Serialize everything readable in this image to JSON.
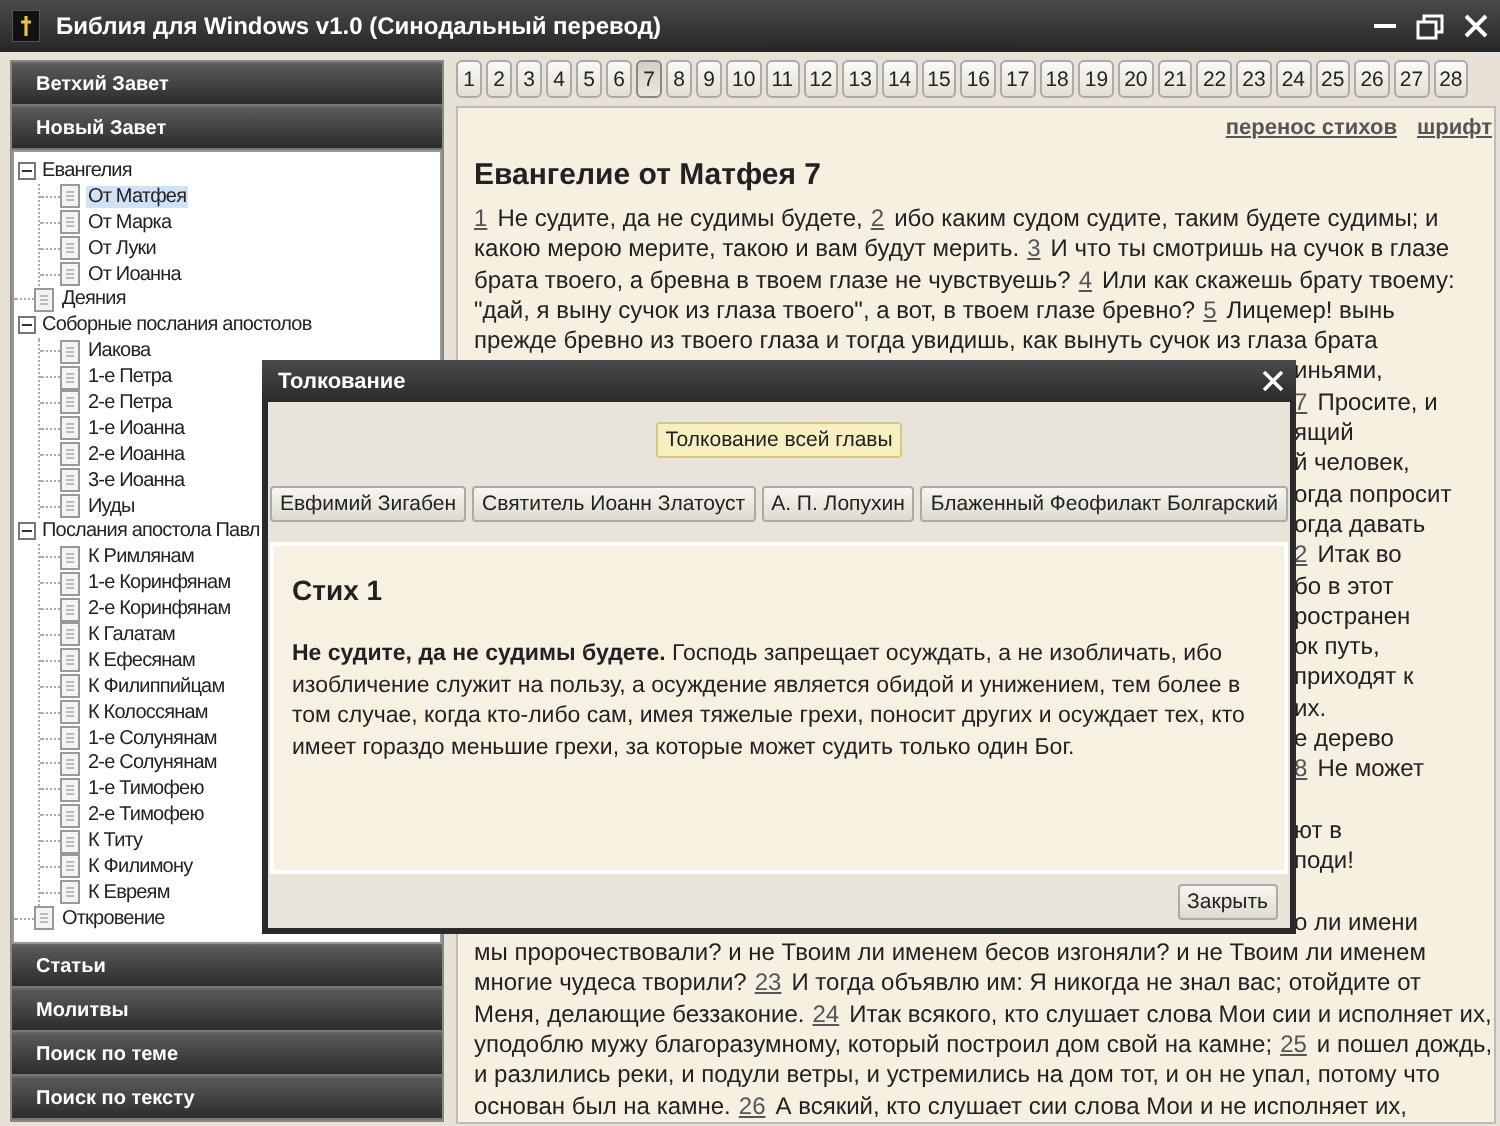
{
  "window": {
    "title": "Библия для Windows v1.0  (Синодальный перевод)"
  },
  "sidebar": {
    "sections_top": [
      "Ветхий Завет",
      "Новый Завет"
    ],
    "tree": [
      {
        "label": "Евангелия",
        "expanded": true,
        "selected": false,
        "children": [
          {
            "label": "От Матфея",
            "selected": true
          },
          {
            "label": "От Марка",
            "selected": false
          },
          {
            "label": "От Луки",
            "selected": false
          },
          {
            "label": "От Иоанна",
            "selected": false
          }
        ]
      },
      {
        "label": "Деяния",
        "selected": false
      },
      {
        "label": "Соборные послания апостолов",
        "expanded": true,
        "selected": false,
        "children": [
          {
            "label": "Иакова",
            "selected": false
          },
          {
            "label": "1-е Петра",
            "selected": false
          },
          {
            "label": "2-е Петра",
            "selected": false
          },
          {
            "label": "1-е Иоанна",
            "selected": false
          },
          {
            "label": "2-е Иоанна",
            "selected": false
          },
          {
            "label": "3-е Иоанна",
            "selected": false
          },
          {
            "label": "Иуды",
            "selected": false
          }
        ]
      },
      {
        "label": "Послания апостола Павл",
        "expanded": true,
        "selected": false,
        "children": [
          {
            "label": "К Римлянам",
            "selected": false
          },
          {
            "label": "1-е Коринфянам",
            "selected": false
          },
          {
            "label": "2-е Коринфянам",
            "selected": false
          },
          {
            "label": "К Галатам",
            "selected": false
          },
          {
            "label": "К Ефесянам",
            "selected": false
          },
          {
            "label": "К Филиппийцам",
            "selected": false
          },
          {
            "label": "К Колоссянам",
            "selected": false
          },
          {
            "label": "1-е Солунянам",
            "selected": false
          },
          {
            "label": "2-е Солунянам",
            "selected": false
          },
          {
            "label": "1-е Тимофею",
            "selected": false
          },
          {
            "label": "2-е Тимофею",
            "selected": false
          },
          {
            "label": "К Титу",
            "selected": false
          },
          {
            "label": "К Филимону",
            "selected": false
          },
          {
            "label": "К Евреям",
            "selected": false
          }
        ]
      },
      {
        "label": "Откровение",
        "selected": false
      }
    ],
    "sections_bottom": [
      "Статьи",
      "Молитвы",
      "Поиск по теме",
      "Поиск по тексту"
    ]
  },
  "chapters": [
    {
      "label": "1",
      "selected": false
    },
    {
      "label": "2",
      "selected": false
    },
    {
      "label": "3",
      "selected": false
    },
    {
      "label": "4",
      "selected": false
    },
    {
      "label": "5",
      "selected": false
    },
    {
      "label": "6",
      "selected": false
    },
    {
      "label": "7",
      "selected": true
    },
    {
      "label": "8",
      "selected": false
    },
    {
      "label": "9",
      "selected": false
    },
    {
      "label": "10",
      "selected": false
    },
    {
      "label": "11",
      "selected": false
    },
    {
      "label": "12",
      "selected": false
    },
    {
      "label": "13",
      "selected": false
    },
    {
      "label": "14",
      "selected": false
    },
    {
      "label": "15",
      "selected": false
    },
    {
      "label": "16",
      "selected": false
    },
    {
      "label": "17",
      "selected": false
    },
    {
      "label": "18",
      "selected": false
    },
    {
      "label": "19",
      "selected": false
    },
    {
      "label": "20",
      "selected": false
    },
    {
      "label": "21",
      "selected": false
    },
    {
      "label": "22",
      "selected": false
    },
    {
      "label": "23",
      "selected": false
    },
    {
      "label": "24",
      "selected": false
    },
    {
      "label": "25",
      "selected": false
    },
    {
      "label": "26",
      "selected": false
    },
    {
      "label": "27",
      "selected": false
    },
    {
      "label": "28",
      "selected": false
    }
  ],
  "reader": {
    "links": [
      "перенос стихов",
      "шрифт"
    ],
    "heading": "Евангелие от Матфея 7",
    "lines": [
      {
        "kind": "full",
        "parts": [
          {
            "kind": "verse",
            "text": "1"
          },
          {
            "kind": "text",
            "text": "Не судите, да не судимы будете,"
          },
          {
            "kind": "verse",
            "text": "2"
          },
          {
            "kind": "text",
            "text": "ибо каким судом судите, таким будете судимы; и"
          }
        ]
      },
      {
        "kind": "full",
        "parts": [
          {
            "kind": "text",
            "text": "какою мерою мерите, такою и вам будут мерить."
          },
          {
            "kind": "verse",
            "text": "3"
          },
          {
            "kind": "text",
            "text": "И что ты смотришь на сучок в глазе"
          }
        ]
      },
      {
        "kind": "full",
        "parts": [
          {
            "kind": "text",
            "text": "брата твоего, а бревна в твоем глазе не чувствуешь?"
          },
          {
            "kind": "verse",
            "text": "4"
          },
          {
            "kind": "text",
            "text": "Или как скажешь брату твоему:"
          }
        ]
      },
      {
        "kind": "full",
        "parts": [
          {
            "kind": "text",
            "text": "\"дай, я выну сучок из глаза твоего\", а вот, в твоем глазе бревно?"
          },
          {
            "kind": "verse",
            "text": "5"
          },
          {
            "kind": "text",
            "text": "Лицемер! вынь"
          }
        ]
      },
      {
        "kind": "full",
        "parts": [
          {
            "kind": "text",
            "text": "прежде бревно из твоего глаза и тогда увидишь, как вынуть сучок из глаза брата"
          }
        ]
      },
      {
        "kind": "tail",
        "parts": [
          {
            "kind": "text",
            "text": "иньями,"
          }
        ]
      },
      {
        "kind": "tail",
        "parts": [
          {
            "kind": "verse",
            "text": "7"
          },
          {
            "kind": "text",
            "text": "Просите, и"
          }
        ]
      },
      {
        "kind": "tail",
        "parts": [
          {
            "kind": "text",
            "text": "ящий"
          }
        ]
      },
      {
        "kind": "tail",
        "parts": [
          {
            "kind": "text",
            "text": "й человек,"
          }
        ]
      },
      {
        "kind": "tail",
        "parts": [
          {
            "kind": "text",
            "text": "огда попросит"
          }
        ]
      },
      {
        "kind": "tail",
        "parts": [
          {
            "kind": "text",
            "text": "огда давать"
          }
        ]
      },
      {
        "kind": "tail",
        "parts": [
          {
            "kind": "verse",
            "text": "2"
          },
          {
            "kind": "text",
            "text": "Итак во"
          }
        ]
      },
      {
        "kind": "tail",
        "parts": [
          {
            "kind": "text",
            "text": "бо в этот"
          }
        ]
      },
      {
        "kind": "tail",
        "parts": [
          {
            "kind": "text",
            "text": "ространен"
          }
        ]
      },
      {
        "kind": "tail",
        "parts": [
          {
            "kind": "text",
            "text": "ок путь,"
          }
        ]
      },
      {
        "kind": "tail",
        "parts": [
          {
            "kind": "text",
            "text": "приходят к"
          }
        ]
      },
      {
        "kind": "tail",
        "parts": [
          {
            "kind": "text",
            "text": "их."
          }
        ]
      },
      {
        "kind": "tail",
        "parts": [
          {
            "kind": "text",
            "text": "е дерево"
          }
        ]
      },
      {
        "kind": "tail",
        "parts": [
          {
            "kind": "verse",
            "text": "8"
          },
          {
            "kind": "text",
            "text": "Не может"
          }
        ]
      },
      {
        "kind": "covered"
      },
      {
        "kind": "tail",
        "parts": [
          {
            "kind": "text",
            "text": "ют в"
          }
        ]
      },
      {
        "kind": "tail",
        "parts": [
          {
            "kind": "text",
            "text": "поди!"
          }
        ]
      },
      {
        "kind": "covered"
      },
      {
        "kind": "tail",
        "parts": [
          {
            "kind": "text",
            "text": "о ли имени"
          }
        ]
      },
      {
        "kind": "full",
        "parts": [
          {
            "kind": "text",
            "text": "мы пророчествовали? и не Твоим ли именем бесов изгоняли? и не Твоим ли именем"
          }
        ]
      },
      {
        "kind": "full",
        "parts": [
          {
            "kind": "text",
            "text": "многие чудеса творили?"
          },
          {
            "kind": "verse",
            "text": "23"
          },
          {
            "kind": "text",
            "text": "И тогда объявлю им: Я никогда не знал вас; отойдите от"
          }
        ]
      },
      {
        "kind": "full",
        "parts": [
          {
            "kind": "text",
            "text": "Меня, делающие беззаконие."
          },
          {
            "kind": "verse",
            "text": "24"
          },
          {
            "kind": "text",
            "text": "Итак всякого, кто слушает слова Мои сии и исполняет их,"
          }
        ]
      },
      {
        "kind": "full",
        "parts": [
          {
            "kind": "text",
            "text": "уподоблю мужу благоразумному, который построил дом свой на камне;"
          },
          {
            "kind": "verse",
            "text": "25"
          },
          {
            "kind": "text",
            "text": "и пошел дождь,"
          }
        ]
      },
      {
        "kind": "full",
        "parts": [
          {
            "kind": "text",
            "text": "и разлились реки, и подули ветры, и устремились на дом тот, и он не упал, потому что"
          }
        ]
      },
      {
        "kind": "full",
        "parts": [
          {
            "kind": "text",
            "text": "основан был на камне."
          },
          {
            "kind": "verse",
            "text": "26"
          },
          {
            "kind": "text",
            "text": "А всякий, кто слушает сии слова Мои и не исполняет их,"
          }
        ]
      }
    ]
  },
  "dialog": {
    "title": "Толкование",
    "chapter_button": {
      "label": "Толкование всей главы",
      "selected": true
    },
    "authors": [
      {
        "label": "Евфимий Зигабен",
        "selected": false
      },
      {
        "label": "Святитель Иоанн Златоуст",
        "selected": false
      },
      {
        "label": "А. П. Лопухин",
        "selected": false
      },
      {
        "label": "Блаженный Феофилакт Болгарский",
        "selected": false
      }
    ],
    "verse_heading": "Стих 1",
    "text": "**Не судите, да не судимы будете.** Господь запрещает осуждать, а не изобличать, ибо изобличение служит на пользу, а осуждение является обидой и унижением, тем более в том случае, когда кто-либо сам, имея тяжелые грехи, поносит других и осуждает тех, кто имеет гораздо меньшие грехи, за которые может судить только один Бог.",
    "close_button": "Закрыть"
  }
}
